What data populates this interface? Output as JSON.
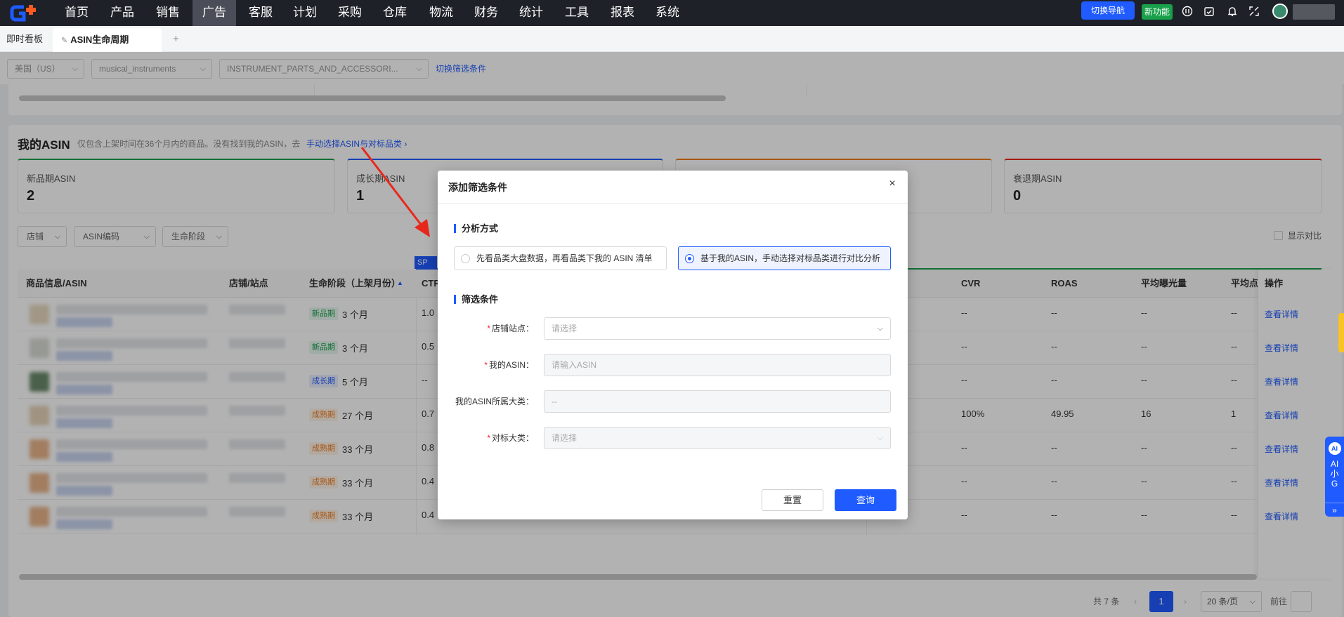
{
  "nav": {
    "items": [
      "首页",
      "产品",
      "销售",
      "广告",
      "客服",
      "计划",
      "采购",
      "仓库",
      "物流",
      "财务",
      "统计",
      "工具",
      "报表",
      "系统"
    ],
    "active": "广告",
    "switch_nav": "切换导航",
    "new_feature": "新功能"
  },
  "tabs": {
    "tab1": "即时看板",
    "tab2": "ASIN生命周期"
  },
  "filters": {
    "country": "美国（US）",
    "category": "musical_instruments",
    "subcategory": "INSTRUMENT_PARTS_AND_ACCESSORI...",
    "switch_link": "切换筛选条件"
  },
  "my_asin": {
    "title": "我的ASIN",
    "note": "仅包含上架时间在36个月内的商品。没有找到我的ASIN，去",
    "link": "手动选择ASIN与对标品类 ›",
    "stats": [
      {
        "label": "新品期ASIN",
        "value": "2"
      },
      {
        "label": "成长期ASIN",
        "value": "1"
      },
      {
        "label": "衰退期ASIN",
        "value": "0"
      }
    ],
    "dropdowns": [
      "店铺",
      "ASIN编码",
      "生命阶段"
    ],
    "compare_label": "显示对比",
    "sp_tag": "SP 广"
  },
  "table": {
    "headers": {
      "product": "商品信息/ASIN",
      "shop": "店铺/站点",
      "stage": "生命阶段（上架月份）",
      "ctr": "CTR",
      "cvr": "CVR",
      "roas": "ROAS",
      "impr": "平均曝光量",
      "avg": "平均点",
      "ops": "操作"
    },
    "rows": [
      {
        "stage": "新品期",
        "months": "3 个月",
        "ctr": "1.0",
        "cvr": "--",
        "roas": "--",
        "impr": "--",
        "avg": "--",
        "action": "查看详情"
      },
      {
        "stage": "新品期",
        "months": "3 个月",
        "ctr": "0.5",
        "cvr": "--",
        "roas": "--",
        "impr": "--",
        "avg": "--",
        "action": "查看详情"
      },
      {
        "stage": "成长期",
        "months": "5 个月",
        "ctr": "--",
        "cvr": "--",
        "roas": "--",
        "impr": "--",
        "avg": "--",
        "action": "查看详情"
      },
      {
        "stage": "成熟期",
        "months": "27 个月",
        "ctr": "0.7",
        "cvr": "100%",
        "roas": "49.95",
        "impr": "16",
        "avg": "1",
        "action": "查看详情"
      },
      {
        "stage": "成熟期",
        "months": "33 个月",
        "ctr": "0.8",
        "cvr": "--",
        "roas": "--",
        "impr": "--",
        "avg": "--",
        "action": "查看详情"
      },
      {
        "stage": "成熟期",
        "months": "33 个月",
        "ctr": "0.4",
        "cvr": "--",
        "roas": "--",
        "impr": "--",
        "avg": "--",
        "action": "查看详情"
      },
      {
        "stage": "成熟期",
        "months": "33 个月",
        "ctr": "0.4",
        "cvr": "--",
        "roas": "--",
        "impr": "--",
        "avg": "--",
        "action": "查看详情"
      }
    ]
  },
  "pagination": {
    "total": "共 7 条",
    "current": "1",
    "page_size": "20 条/页",
    "goto": "前往"
  },
  "side": {
    "ai_label": "AI小G"
  },
  "dialog": {
    "title": "添加筛选条件",
    "section1": "分析方式",
    "option1": "先看品类大盘数据，再看品类下我的 ASIN 清单",
    "option2": "基于我的ASIN，手动选择对标品类进行对比分析",
    "section2": "筛选条件",
    "fields": {
      "shop_label": "店铺站点：",
      "shop_placeholder": "请选择",
      "asin_label": "我的ASIN：",
      "asin_placeholder": "请输入ASIN",
      "category_label": "我的ASIN所属大类：",
      "category_value": "--",
      "bench_label": "对标大类：",
      "bench_placeholder": "请选择"
    },
    "reset": "重置",
    "query": "查询"
  },
  "colors": {
    "primary": "#1f5bff",
    "nav_bg": "#1f2129",
    "green": "#19a04b",
    "orange": "#f07c1c",
    "arrow": "#e8281d"
  }
}
